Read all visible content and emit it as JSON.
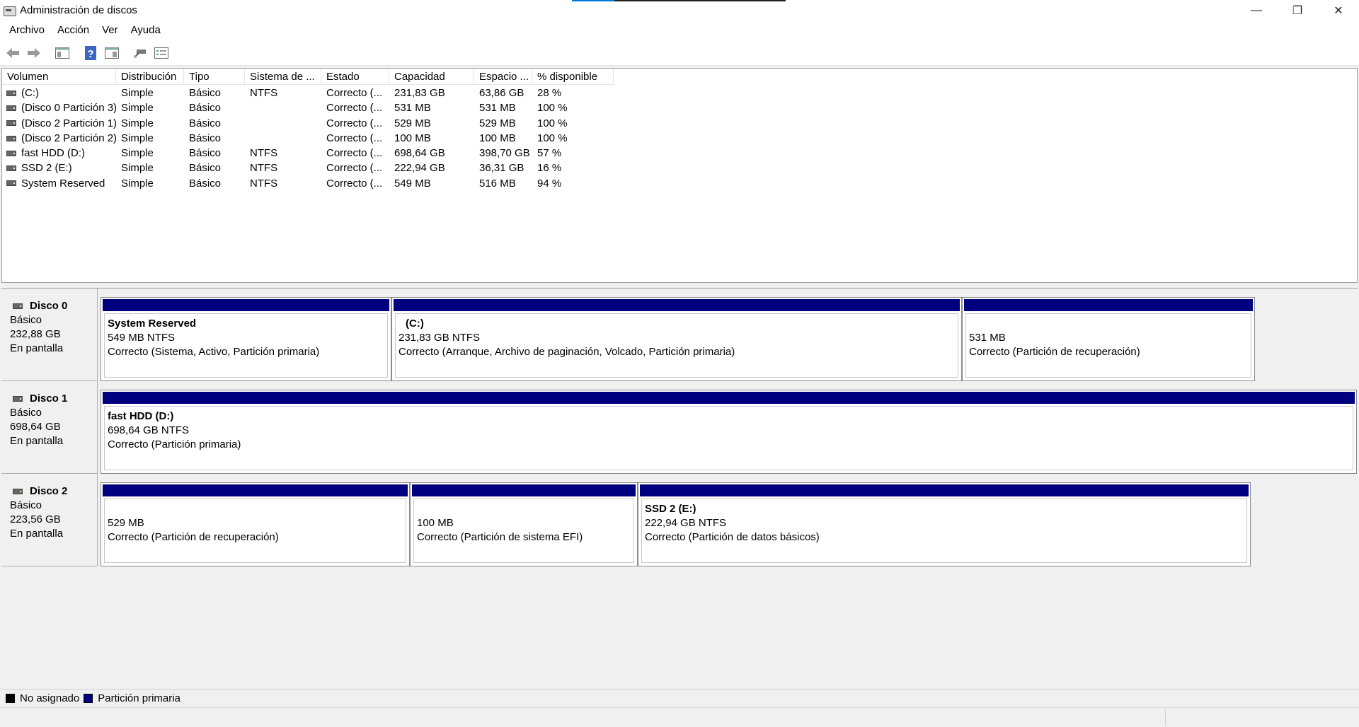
{
  "window": {
    "title": "Administración de discos",
    "minimize_glyph": "—",
    "restore_glyph": "❐",
    "close_glyph": "✕"
  },
  "menu": [
    "Archivo",
    "Acción",
    "Ver",
    "Ayuda"
  ],
  "toolbar": {
    "icons": [
      "back-arrow-icon",
      "forward-arrow-icon",
      "show-hide-console-tree-icon",
      "help-icon",
      "properties-icon",
      "connect-disk-icon",
      "settings-list-icon"
    ]
  },
  "volume_list": {
    "columns": [
      "Volumen",
      "Distribución",
      "Tipo",
      "Sistema de ...",
      "Estado",
      "Capacidad",
      "Espacio ...",
      "% disponible"
    ],
    "rows": [
      [
        "(C:)",
        "Simple",
        "Básico",
        "NTFS",
        "Correcto (...",
        "231,83 GB",
        "63,86 GB",
        "28 %"
      ],
      [
        "(Disco 0 Partición 3)",
        "Simple",
        "Básico",
        "",
        "Correcto (...",
        "531 MB",
        "531 MB",
        "100 %"
      ],
      [
        "(Disco 2 Partición 1)",
        "Simple",
        "Básico",
        "",
        "Correcto (...",
        "529 MB",
        "529 MB",
        "100 %"
      ],
      [
        "(Disco 2 Partición 2)",
        "Simple",
        "Básico",
        "",
        "Correcto (...",
        "100 MB",
        "100 MB",
        "100 %"
      ],
      [
        "fast HDD (D:)",
        "Simple",
        "Básico",
        "NTFS",
        "Correcto (...",
        "698,64 GB",
        "398,70 GB",
        "57 %"
      ],
      [
        "SSD 2 (E:)",
        "Simple",
        "Básico",
        "NTFS",
        "Correcto (...",
        "222,94 GB",
        "36,31 GB",
        "16 %"
      ],
      [
        "System Reserved",
        "Simple",
        "Básico",
        "NTFS",
        "Correcto (...",
        "549 MB",
        "516 MB",
        "94 %"
      ]
    ]
  },
  "disks": [
    {
      "name": "Disco 0",
      "type": "Básico",
      "size": "232,88 GB",
      "status": "En pantalla",
      "partitions": [
        {
          "title": "System Reserved",
          "size": "549 MB NTFS",
          "status": "Correcto (Sistema, Activo, Partición primaria)"
        },
        {
          "title": "(C:)",
          "size": "231,83 GB NTFS",
          "status": "Correcto (Arranque, Archivo de paginación, Volcado, Partición primaria)"
        },
        {
          "title": "",
          "size": "531 MB",
          "status": "Correcto (Partición de recuperación)"
        }
      ]
    },
    {
      "name": "Disco 1",
      "type": "Básico",
      "size": "698,64 GB",
      "status": "En pantalla",
      "partitions": [
        {
          "title": "fast HDD  (D:)",
          "size": "698,64 GB NTFS",
          "status": "Correcto (Partición primaria)"
        }
      ]
    },
    {
      "name": "Disco 2",
      "type": "Básico",
      "size": "223,56 GB",
      "status": "En pantalla",
      "partitions": [
        {
          "title": "",
          "size": "529 MB",
          "status": "Correcto (Partición de recuperación)"
        },
        {
          "title": "",
          "size": "100 MB",
          "status": "Correcto (Partición de sistema EFI)"
        },
        {
          "title": "SSD 2  (E:)",
          "size": "222,94 GB NTFS",
          "status": "Correcto (Partición de datos básicos)"
        }
      ]
    }
  ],
  "legend": [
    {
      "label": "No asignado",
      "color": "#000000"
    },
    {
      "label": "Partición primaria",
      "color": "#00007f"
    }
  ]
}
